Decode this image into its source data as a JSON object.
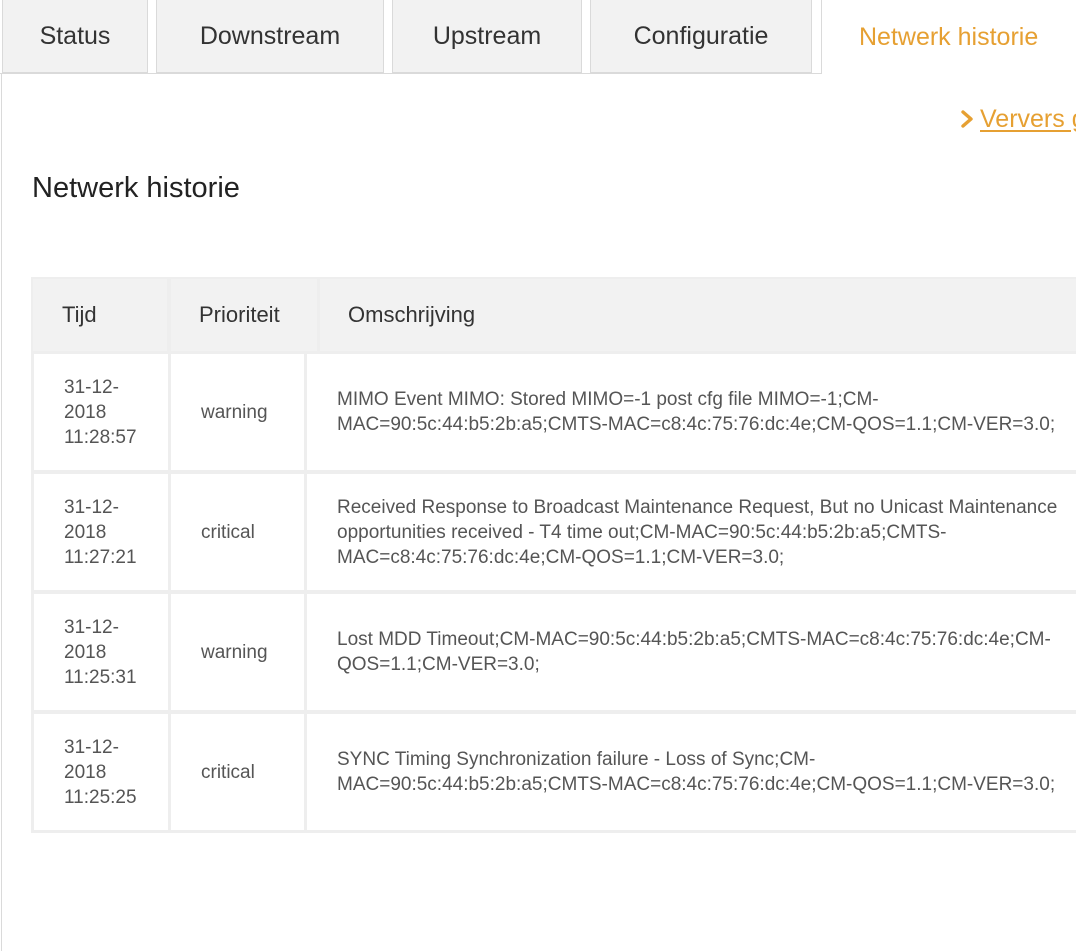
{
  "tabs": [
    {
      "label": "Status",
      "active": false
    },
    {
      "label": "Downstream",
      "active": false
    },
    {
      "label": "Upstream",
      "active": false
    },
    {
      "label": "Configuratie",
      "active": false
    },
    {
      "label": "Netwerk historie",
      "active": true
    }
  ],
  "refresh": {
    "label": "Ververs gegevens",
    "icon": "chevron-right-icon"
  },
  "page_title": "Netwerk historie",
  "table": {
    "headers": [
      "Tijd",
      "Prioriteit",
      "Omschrijving"
    ],
    "rows": [
      {
        "time": "31-12-\n2018\n11:28:57",
        "priority": "warning",
        "description_lines": [
          "MIMO Event MIMO: Stored MIMO=-1 post cfg file MIMO=-1;CM-",
          "MAC=90:5c:44:b5:2b:a5;CMTS-MAC=c8:4c:75:76:dc:4e;CM-QOS=1.1;CM-VER=3.0;"
        ]
      },
      {
        "time": "31-12-\n2018\n11:27:21",
        "priority": "critical",
        "description_lines": [
          "Received Response to Broadcast Maintenance Request, But no Unicast Maintenance",
          "opportunities received - T4 time out;CM-MAC=90:5c:44:b5:2b:a5;CMTS-",
          "MAC=c8:4c:75:76:dc:4e;CM-QOS=1.1;CM-VER=3.0;"
        ]
      },
      {
        "time": "31-12-\n2018\n11:25:31",
        "priority": "warning",
        "description_lines": [
          "Lost MDD Timeout;CM-MAC=90:5c:44:b5:2b:a5;CMTS-MAC=c8:4c:75:76:dc:4e;CM-",
          "QOS=1.1;CM-VER=3.0;"
        ]
      },
      {
        "time": "31-12-\n2018\n11:25:25",
        "priority": "critical",
        "description_lines": [
          "SYNC Timing Synchronization failure - Loss of Sync;CM-",
          "MAC=90:5c:44:b5:2b:a5;CMTS-MAC=c8:4c:75:76:dc:4e;CM-QOS=1.1;CM-VER=3.0;"
        ]
      }
    ]
  },
  "colors": {
    "accent": "#e6a032",
    "tab_bg": "#f2f2f2",
    "border": "#dadada",
    "text": "#333333"
  }
}
